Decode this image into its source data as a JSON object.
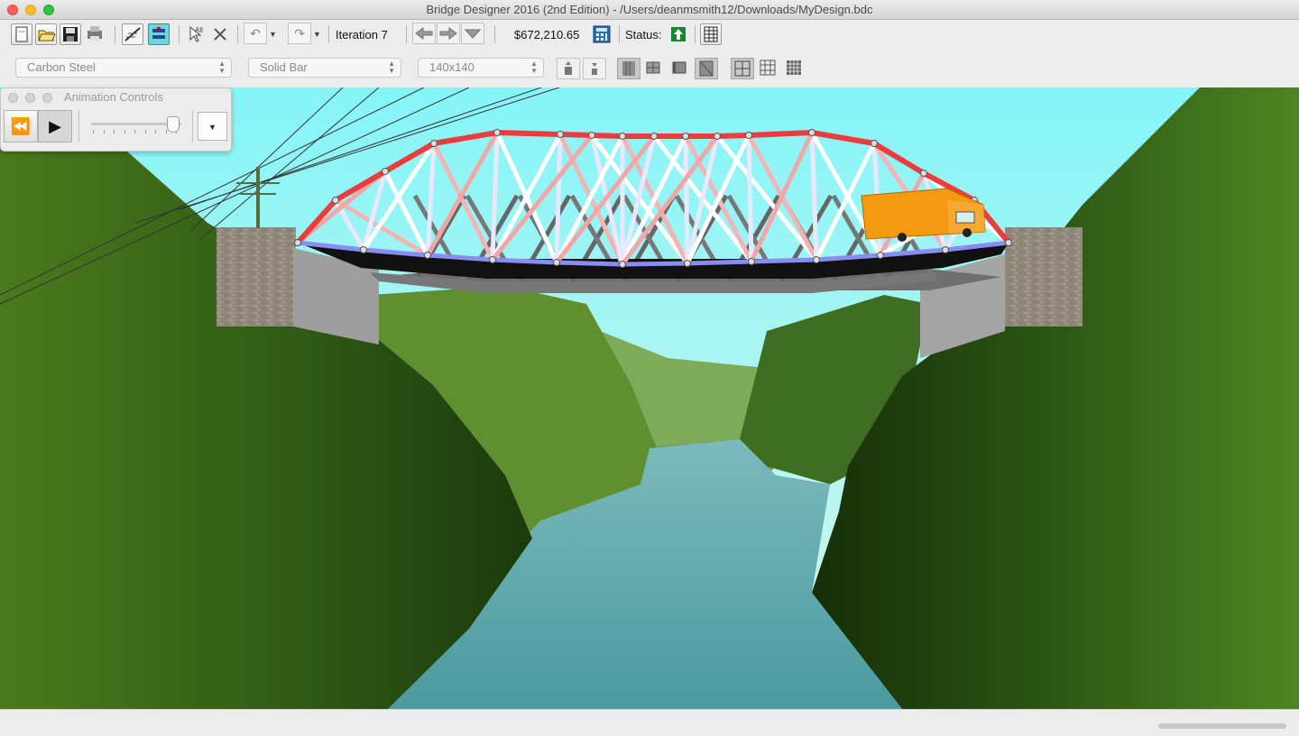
{
  "window": {
    "title": "Bridge Designer 2016 (2nd Edition) - /Users/deanmsmith12/Downloads/MyDesign.bdc"
  },
  "toolbar": {
    "iteration_label": "Iteration 7",
    "cost": "$672,210.65",
    "status_label": "Status:",
    "status_icon": "green-up-arrow-icon"
  },
  "selectors": {
    "material": "Carbon Steel",
    "section": "Solid Bar",
    "size": "140x140"
  },
  "animation_panel": {
    "title": "Animation Controls",
    "speed_fraction": 0.95
  },
  "colors": {
    "compression": "#ee3b3b",
    "tension": "#8a8cf2",
    "sky": "#8ff7f7",
    "river": "#4f9ea2"
  }
}
